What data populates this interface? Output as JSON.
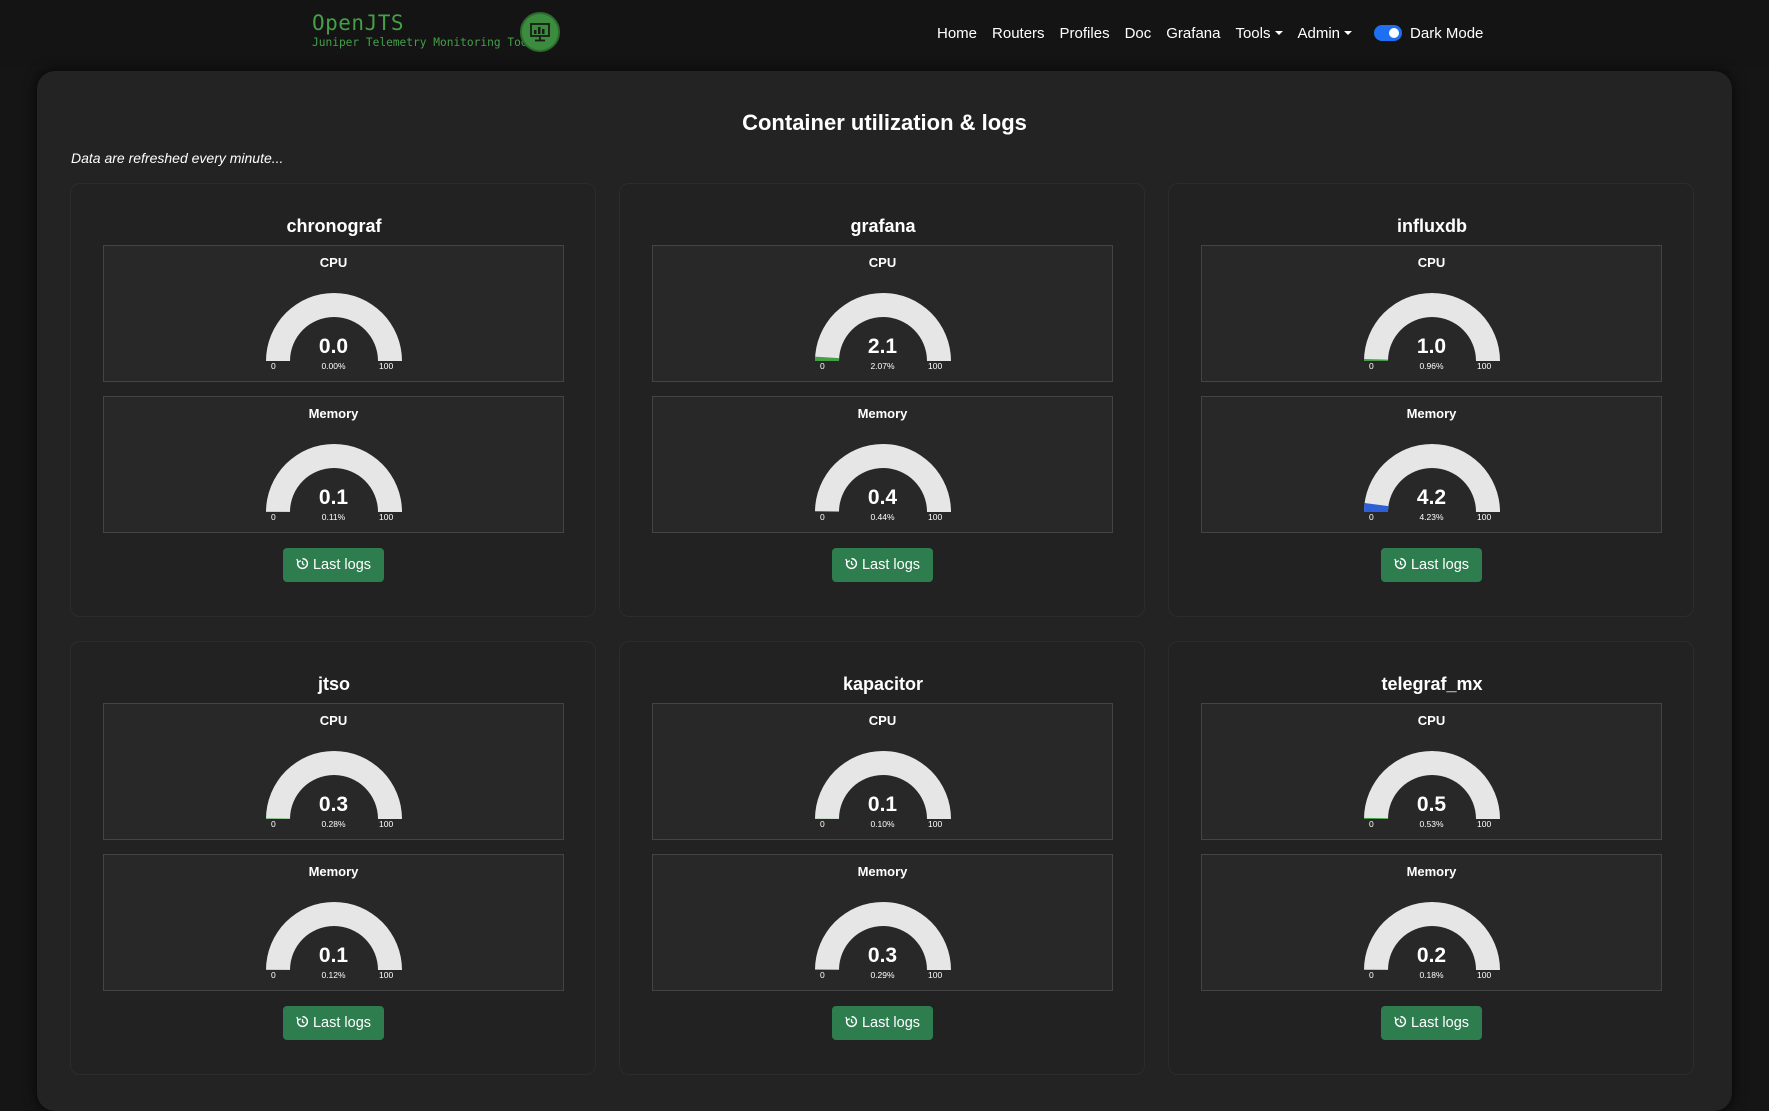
{
  "brand": {
    "name": "OpenJTS",
    "subtitle": "Juniper Telemetry Monitoring Tool"
  },
  "nav": {
    "items": [
      "Home",
      "Routers",
      "Profiles",
      "Doc",
      "Grafana"
    ],
    "tools": "Tools",
    "admin": "Admin",
    "dark_mode_label": "Dark Mode",
    "dark_mode_on": true
  },
  "page": {
    "title": "Container utilization & logs",
    "refresh_note": "Data are refreshed every minute..."
  },
  "colors": {
    "cpu_fill": "#43a047",
    "memory_fill": "#2f5fd8",
    "gauge_track": "#e6e6e6",
    "button": "#2e7d4f"
  },
  "labels": {
    "cpu": "CPU",
    "memory": "Memory",
    "last_logs": "Last logs",
    "gauge_min": "0",
    "gauge_max": "100"
  },
  "containers": [
    {
      "name": "chronograf",
      "cpu": {
        "value": "0.0",
        "percent": "0.00%",
        "level": 0.0
      },
      "memory": {
        "value": "0.1",
        "percent": "0.11%",
        "level": 0.11
      }
    },
    {
      "name": "grafana",
      "cpu": {
        "value": "2.1",
        "percent": "2.07%",
        "level": 2.07
      },
      "memory": {
        "value": "0.4",
        "percent": "0.44%",
        "level": 0.44
      }
    },
    {
      "name": "influxdb",
      "cpu": {
        "value": "1.0",
        "percent": "0.96%",
        "level": 0.96
      },
      "memory": {
        "value": "4.2",
        "percent": "4.23%",
        "level": 4.23
      }
    },
    {
      "name": "jtso",
      "cpu": {
        "value": "0.3",
        "percent": "0.28%",
        "level": 0.28
      },
      "memory": {
        "value": "0.1",
        "percent": "0.12%",
        "level": 0.12
      }
    },
    {
      "name": "kapacitor",
      "cpu": {
        "value": "0.1",
        "percent": "0.10%",
        "level": 0.1
      },
      "memory": {
        "value": "0.3",
        "percent": "0.29%",
        "level": 0.29
      }
    },
    {
      "name": "telegraf_mx",
      "cpu": {
        "value": "0.5",
        "percent": "0.53%",
        "level": 0.53
      },
      "memory": {
        "value": "0.2",
        "percent": "0.18%",
        "level": 0.18
      }
    }
  ]
}
